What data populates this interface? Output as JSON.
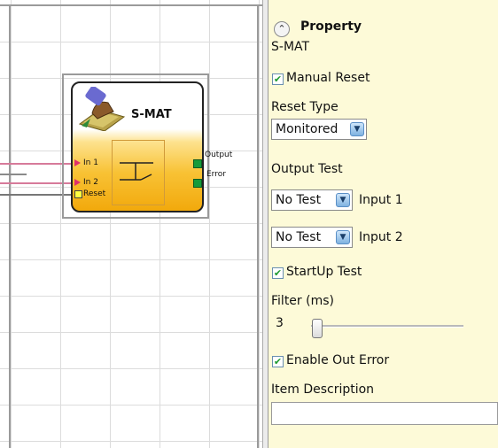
{
  "canvas": {
    "block": {
      "title": "S-MAT",
      "inputs": [
        "In 1",
        "In 2",
        "Reset"
      ],
      "outputs": [
        "Output",
        "Error"
      ]
    }
  },
  "property": {
    "title": "Property",
    "header_icon": "chevron-up-icon",
    "block_name": "S-MAT",
    "manual_reset": {
      "label": "Manual Reset",
      "checked": true
    },
    "reset_type": {
      "label": "Reset Type",
      "value": "Monitored"
    },
    "output_test": {
      "label": "Output Test"
    },
    "input1": {
      "value": "No Test",
      "label": "Input 1"
    },
    "input2": {
      "value": "No Test",
      "label": "Input 2"
    },
    "startup_test": {
      "label": "StartUp Test",
      "checked": true
    },
    "filter": {
      "label": "Filter (ms)",
      "value": "3"
    },
    "enable_out_error": {
      "label": "Enable Out Error",
      "checked": true
    },
    "item_description": {
      "label": "Item Description",
      "value": ""
    }
  },
  "colors": {
    "panel_bg": "#fdfad8",
    "block_orange": "#f2a90c",
    "check_green": "#1e9a2e",
    "input_arrow": "#e0306a",
    "output_green": "#149b3a"
  }
}
